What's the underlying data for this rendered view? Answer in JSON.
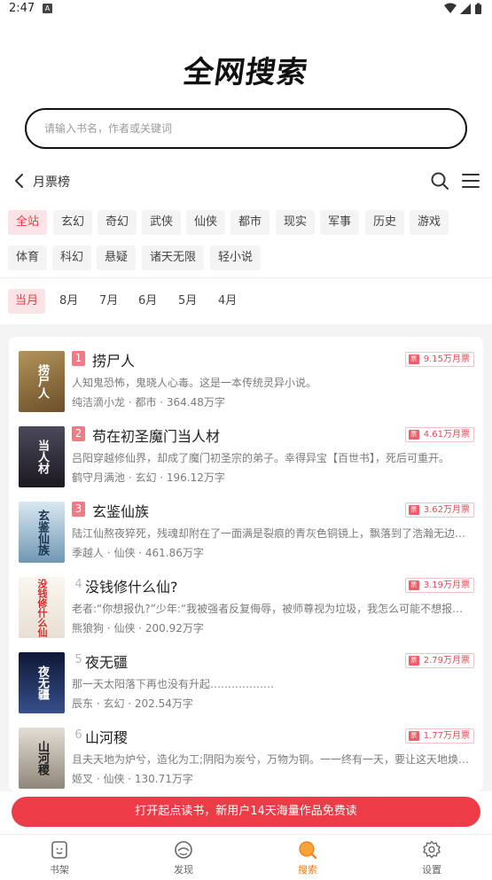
{
  "status": {
    "time": "2:47",
    "a_badge": "A"
  },
  "brand": {
    "title": "全网搜索"
  },
  "search": {
    "placeholder": "请输入书名，作者或关键词",
    "value": ""
  },
  "nav": {
    "title": "月票榜"
  },
  "categories": [
    "全站",
    "玄幻",
    "奇幻",
    "武侠",
    "仙侠",
    "都市",
    "现实",
    "军事",
    "历史",
    "游戏",
    "体育",
    "科幻",
    "悬疑",
    "诸天无限",
    "轻小说"
  ],
  "active_category": "全站",
  "months": [
    "当月",
    "8月",
    "7月",
    "6月",
    "5月",
    "4月"
  ],
  "active_month": "当月",
  "books": [
    {
      "rank": "1",
      "title": "捞尸人",
      "votes": "9.15万月票",
      "desc": "人知鬼恐怖，鬼晓人心毒。这是一本传统灵异小说。",
      "meta": "纯洁滴小龙 · 都市 · 364.48万字",
      "cover_text": "捞尸人",
      "cover_color": "#7a5a2f"
    },
    {
      "rank": "2",
      "title": "苟在初圣魔门当人材",
      "votes": "4.61万月票",
      "desc": "吕阳穿越修仙界，却成了魔门初圣宗的弟子。幸得异宝【百世书】，死后可重开。",
      "meta": "鹤守月满池 · 玄幻 · 196.12万字",
      "cover_text": "当人材",
      "cover_color": "#2a2530"
    },
    {
      "rank": "3",
      "title": "玄鉴仙族",
      "votes": "3.62万月票",
      "desc": "陆江仙熬夜猝死，残魂却附在了一面满是裂痕的青灰色铜镜上，飘落到了浩瀚无边的修仙世界。",
      "meta": "季越人 · 仙侠 · 461.86万字",
      "cover_text": "玄鉴仙族",
      "cover_color": "#8fb4c9"
    },
    {
      "rank": "4",
      "title": "没钱修什么仙?",
      "votes": "3.19万月票",
      "desc": "老者:“你想报仇?”少年:“我被强者反复侮辱，被师尊视为垃圾，我怎么可能不想报仇?”",
      "meta": "熊狼狗 · 仙侠 · 200.92万字",
      "cover_text": "没钱修什么仙",
      "cover_color": "#f3efe8"
    },
    {
      "rank": "5",
      "title": "夜无疆",
      "votes": "2.79万月票",
      "desc": "那一天太阳落下再也没有升起………………",
      "meta": "辰东 · 玄幻 · 202.54万字",
      "cover_text": "夜无疆",
      "cover_color": "#1d2a52"
    },
    {
      "rank": "6",
      "title": "山河稷",
      "votes": "1.77万月票",
      "desc": "且夫天地为炉兮，造化为工;阴阳为炭兮，万物为铜。一一终有一天，要让这天地焕然一新。",
      "meta": "姬叉 · 仙侠 · 130.71万字",
      "cover_text": "山河稷",
      "cover_color": "#c9c2b4"
    }
  ],
  "promo": {
    "text": "打开起点读书，新用户14天海量作品免费读"
  },
  "tabs": [
    {
      "label": "书架",
      "icon": "bookshelf-icon"
    },
    {
      "label": "发现",
      "icon": "discover-icon"
    },
    {
      "label": "搜索",
      "icon": "search-icon"
    },
    {
      "label": "设置",
      "icon": "settings-icon"
    }
  ],
  "colors": {
    "accent": "#ea3a46",
    "chip_active_bg": "#fbe4e6",
    "tab_active": "#f27b1a",
    "rank_badge": "#f07b84"
  }
}
